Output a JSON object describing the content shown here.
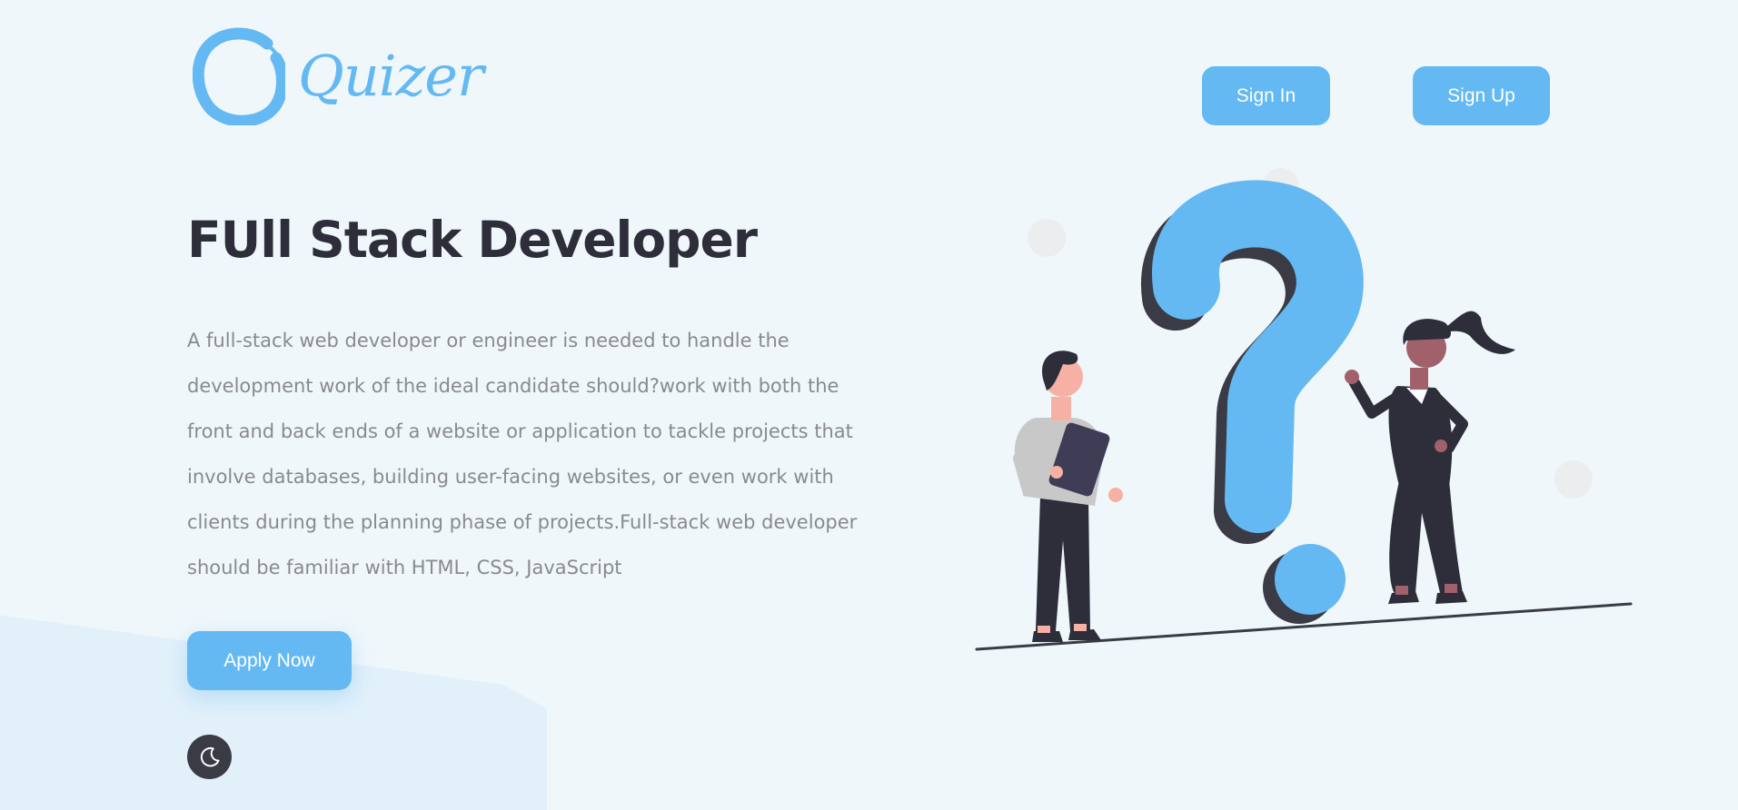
{
  "header": {
    "brand_name": "Quizer",
    "signin_label": "Sign In",
    "signup_label": "Sign Up"
  },
  "hero": {
    "title": "FUll Stack Developer",
    "description": "A full-stack web developer or engineer is needed to handle the development work of the ideal candidate should?work with both the front and back ends of a website or application to tackle projects that involve databases, building user-facing websites, or even work with clients during the planning phase of projects.Full-stack web developer should be familiar with HTML, CSS, JavaScript",
    "apply_label": "Apply Now"
  },
  "theme_toggle": {
    "icon": "moon-icon"
  },
  "illustration": {
    "icon": "question-mark-people-illustration"
  },
  "colors": {
    "accent": "#64b9f2",
    "background": "#eff7fb",
    "title": "#2d2e3a",
    "text": "#8a8a8a",
    "dark": "#3a3b45"
  }
}
